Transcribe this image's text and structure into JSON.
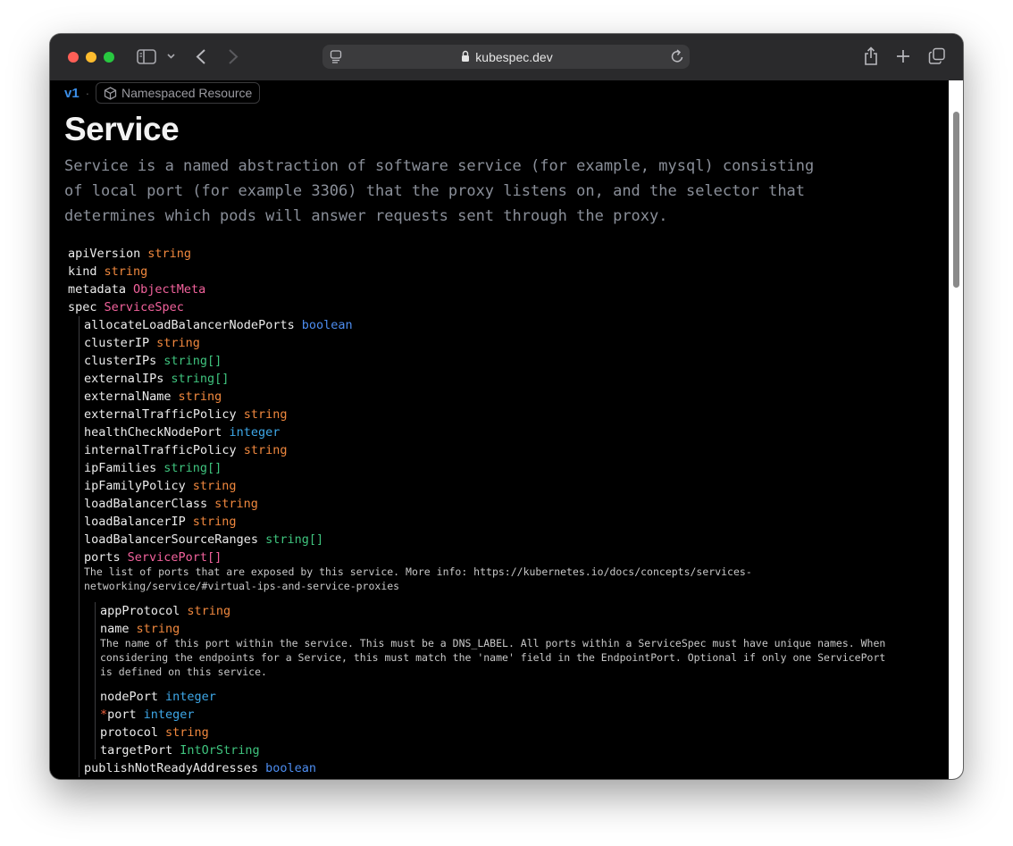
{
  "browser": {
    "url": "kubespec.dev",
    "icons": [
      "sidebar-icon",
      "chevron-down-icon",
      "back-icon",
      "forward-icon",
      "page-icon",
      "lock-icon",
      "reload-icon",
      "share-icon",
      "new-tab-icon",
      "tabs-icon"
    ]
  },
  "header": {
    "version": "v1",
    "separator": "·",
    "badge": "Namespaced Resource",
    "title": "Service",
    "description_lines": [
      "Service is a named abstraction of software service (for example, mysql) consisting",
      "of local port (for example 3306) that the proxy listens on, and the selector that",
      "determines which pods will answer requests sent through the proxy."
    ]
  },
  "colors": {
    "string": "#f0883e",
    "object": "#f2629c",
    "array": "#3fc47e",
    "boolean": "#4d8df0",
    "integer": "#3ea8e8"
  },
  "top_fields": [
    {
      "name": "apiVersion",
      "type": "string"
    },
    {
      "name": "kind",
      "type": "string"
    },
    {
      "name": "metadata",
      "type": "ObjectMeta"
    },
    {
      "name": "spec",
      "type": "ServiceSpec"
    }
  ],
  "spec_fields": [
    {
      "name": "allocateLoadBalancerNodePorts",
      "type": "boolean"
    },
    {
      "name": "clusterIP",
      "type": "string"
    },
    {
      "name": "clusterIPs",
      "type": "string[]"
    },
    {
      "name": "externalIPs",
      "type": "string[]"
    },
    {
      "name": "externalName",
      "type": "string"
    },
    {
      "name": "externalTrafficPolicy",
      "type": "string"
    },
    {
      "name": "healthCheckNodePort",
      "type": "integer"
    },
    {
      "name": "internalTrafficPolicy",
      "type": "string"
    },
    {
      "name": "ipFamilies",
      "type": "string[]"
    },
    {
      "name": "ipFamilyPolicy",
      "type": "string"
    },
    {
      "name": "loadBalancerClass",
      "type": "string"
    },
    {
      "name": "loadBalancerIP",
      "type": "string"
    },
    {
      "name": "loadBalancerSourceRanges",
      "type": "string[]"
    },
    {
      "name": "ports",
      "type": "ServicePort[]"
    }
  ],
  "ports_description": "The list of ports that are exposed by this service. More info: https://kubernetes.io/docs/concepts/services-\nnetworking/service/#virtual-ips-and-service-proxies",
  "port_fields": [
    {
      "name": "appProtocol",
      "type": "string"
    },
    {
      "name": "name",
      "type": "string"
    }
  ],
  "name_description": "The name of this port within the service. This must be a DNS_LABEL. All ports within a ServiceSpec must have unique names. When\nconsidering the endpoints for a Service, this must match the 'name' field in the EndpointPort. Optional if only one ServicePort\nis defined on this service.",
  "port_fields_2": [
    {
      "name": "nodePort",
      "type": "integer"
    },
    {
      "name": "port",
      "type": "integer",
      "required_mark": "*"
    },
    {
      "name": "protocol",
      "type": "string"
    },
    {
      "name": "targetPort",
      "type": "IntOrString"
    }
  ],
  "spec_fields_after": [
    {
      "name": "publishNotReadyAddresses",
      "type": "boolean"
    }
  ]
}
